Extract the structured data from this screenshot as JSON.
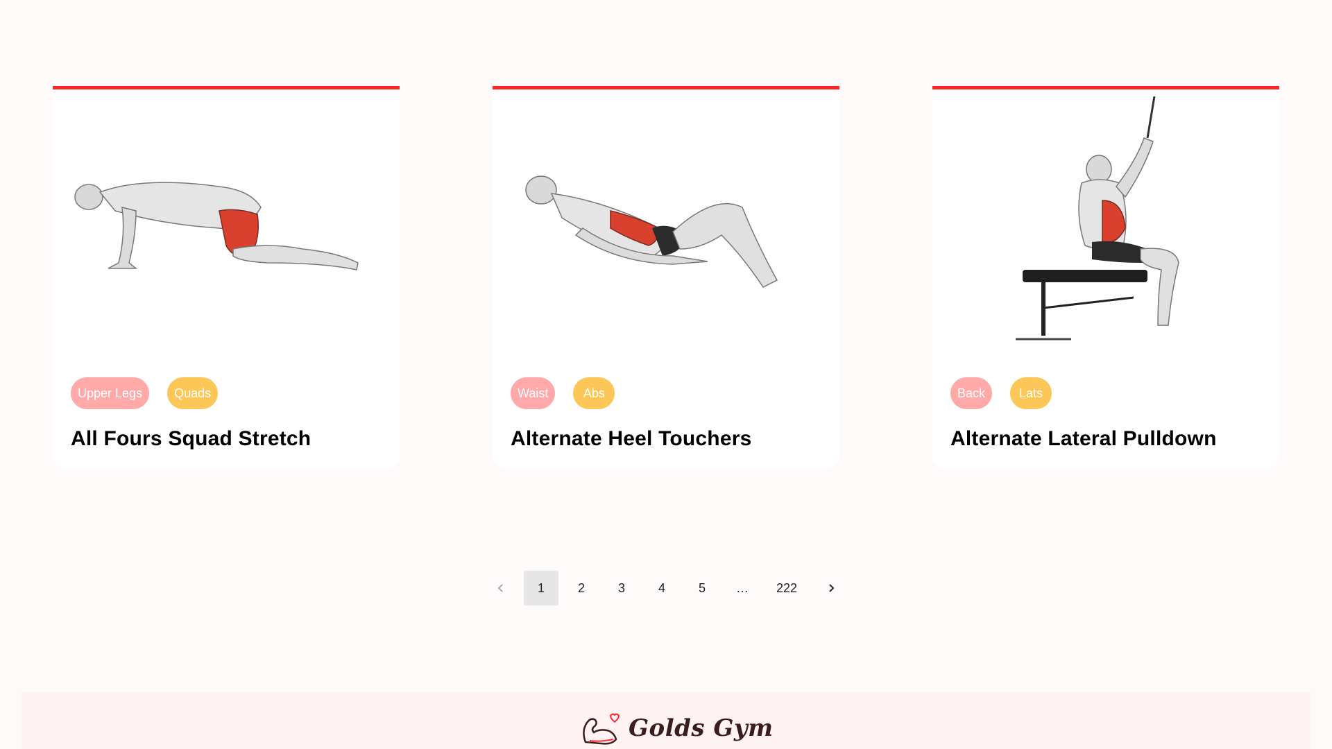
{
  "cards": [
    {
      "title": "All Fours Squad Stretch",
      "body_part": "Upper Legs",
      "target": "Quads",
      "image_icon": "exercise-illustration-kneeling-stretch"
    },
    {
      "title": "Alternate Heel Touchers",
      "body_part": "Waist",
      "target": "Abs",
      "image_icon": "exercise-illustration-lying-crunch"
    },
    {
      "title": "Alternate Lateral Pulldown",
      "body_part": "Back",
      "target": "Lats",
      "image_icon": "exercise-illustration-cable-pulldown"
    }
  ],
  "pagination": {
    "prev_icon": "chevron-left-icon",
    "pages": [
      "1",
      "2",
      "3",
      "4",
      "5",
      "…",
      "222"
    ],
    "current": "1",
    "next_icon": "chevron-right-icon"
  },
  "footer": {
    "logo_text": "Golds Gym",
    "logo_icon": "flexed-arm-heart-icon"
  },
  "colors": {
    "accent": "#ff2625",
    "body_tag": "#ffa9a9",
    "target_tag": "#fcc757",
    "page_bg": "#fffafa",
    "footer_bg": "#fff3f4"
  }
}
